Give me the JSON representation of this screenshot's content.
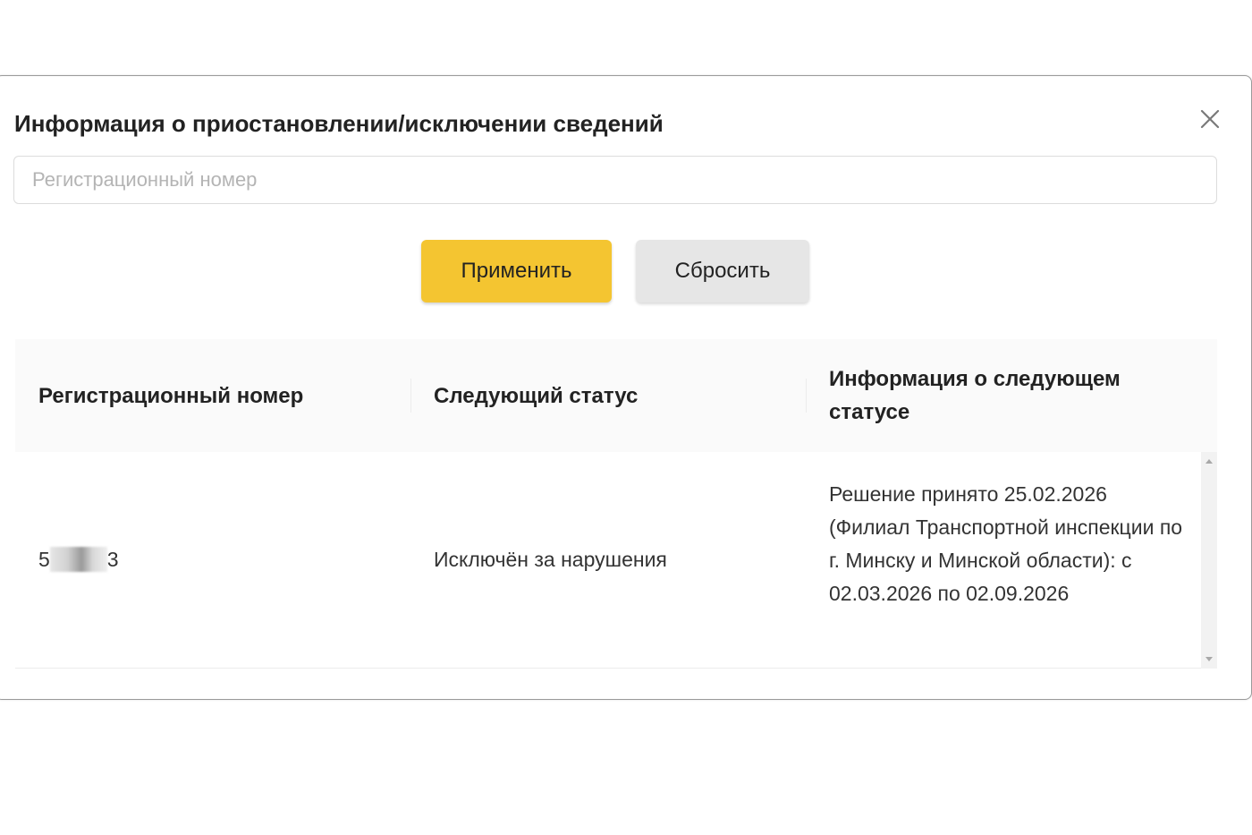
{
  "modal": {
    "title": "Информация о приостановлении/исключении сведений",
    "close_icon": "close-icon"
  },
  "search": {
    "placeholder": "Регистрационный номер",
    "value": ""
  },
  "buttons": {
    "apply_label": "Применить",
    "reset_label": "Сбросить",
    "apply_color": "#f4c531",
    "reset_color": "#e6e6e6"
  },
  "table": {
    "columns": [
      "Регистрационный номер",
      "Следующий статус",
      "Информация о следующем статусе"
    ],
    "rows": [
      {
        "reg_prefix": "5",
        "reg_suffix": "3",
        "status": "Исключён за нарушения",
        "info": "Решение принято 25.02.2026 (Филиал Транспортной инспекции по г. Минску и Минской области): с 02.03.2026 по 02.09.2026"
      }
    ]
  }
}
